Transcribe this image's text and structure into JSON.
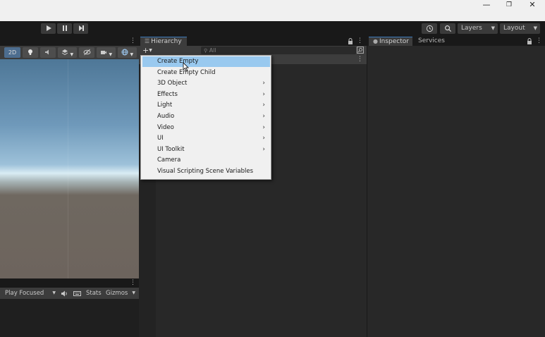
{
  "window": {
    "minimize_glyph": "—",
    "restore_glyph": "❐",
    "close_glyph": "✕"
  },
  "toolbar": {
    "play_icon": "play-icon",
    "pause_icon": "pause-icon",
    "step_icon": "step-icon",
    "layers_label": "Layers",
    "layout_label": "Layout"
  },
  "scene": {
    "mode_2d_label": "2D"
  },
  "game": {
    "play_mode_label": "Play Focused",
    "stats_label": "Stats",
    "gizmos_label": "Gizmos"
  },
  "hierarchy": {
    "tab_label": "Hierarchy",
    "add_label": "+",
    "search_placeholder": "All"
  },
  "inspector": {
    "tab_label": "Inspector",
    "services_label": "Services"
  },
  "context_menu": {
    "items": [
      {
        "label": "Create Empty",
        "submenu": false,
        "selected": true
      },
      {
        "label": "Create Empty Child",
        "submenu": false,
        "selected": false
      },
      {
        "label": "3D Object",
        "submenu": true,
        "selected": false
      },
      {
        "label": "Effects",
        "submenu": true,
        "selected": false
      },
      {
        "label": "Light",
        "submenu": true,
        "selected": false
      },
      {
        "label": "Audio",
        "submenu": true,
        "selected": false
      },
      {
        "label": "Video",
        "submenu": true,
        "selected": false
      },
      {
        "label": "UI",
        "submenu": true,
        "selected": false
      },
      {
        "label": "UI Toolkit",
        "submenu": true,
        "selected": false
      },
      {
        "label": "Camera",
        "submenu": false,
        "selected": false
      },
      {
        "label": "Visual Scripting Scene Variables",
        "submenu": false,
        "selected": false
      }
    ],
    "submenu_chevron": "›"
  },
  "colors": {
    "accent": "#3a79bb",
    "menu_highlight": "#99c9ef",
    "panel_bg": "#282828"
  }
}
